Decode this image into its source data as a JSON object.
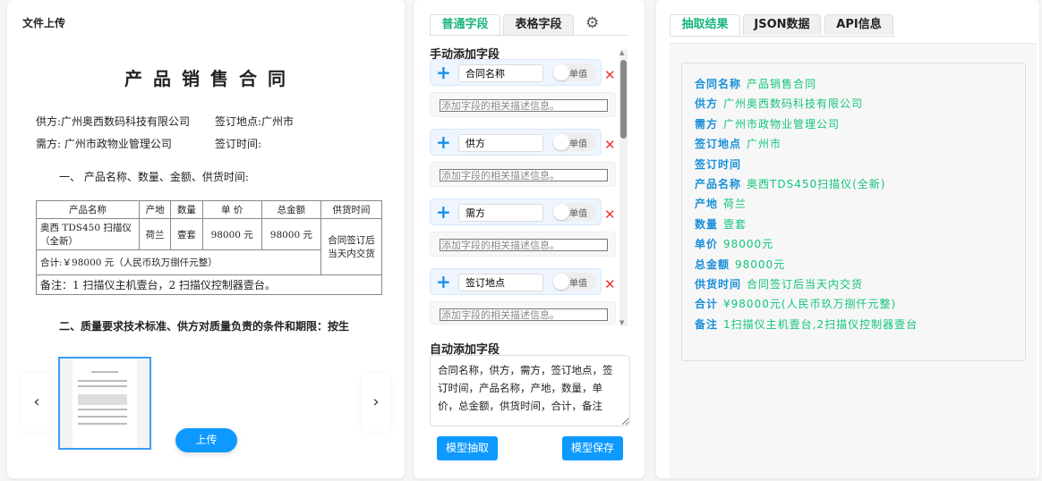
{
  "left": {
    "title": "文件上传",
    "upload_label": "上传",
    "prev_icon": "chevron-left",
    "next_icon": "chevron-right",
    "document": {
      "title": "产品销售合同",
      "supplier": "供方:广州奥西数码科技有限公司",
      "sign_place": "签订地点:广州市",
      "buyer": "需方: 广州市政物业管理公司",
      "sign_time": "签订时间:",
      "section1": "一、  产品名称、数量、金额、供货时间:",
      "table_headers": [
        "产品名称",
        "产地",
        "数量",
        "单 价",
        "总金额",
        "供货时间"
      ],
      "table_row": [
        "奥西 TDS450 扫描仪（全新）",
        "荷兰",
        "壹套",
        "98000 元",
        "98000 元",
        "合同签订后当天内交货"
      ],
      "total": "合计:￥98000 元（人民币玖万捌仟元整）",
      "note": "备注：1 扫描仪主机壹台，2 扫描仪控制器壹台。",
      "section2": "二、质量要求技术标准、供方对质量负责的条件和期限：按生"
    }
  },
  "middle": {
    "tabs": [
      "普通字段",
      "表格字段"
    ],
    "settings_icon": "gear",
    "manual_label": "手动添加字段",
    "toggle_label": "单值",
    "desc_placeholder": "添加字段的相关描述信息。",
    "fields": [
      "合同名称",
      "供方",
      "需方",
      "签订地点"
    ],
    "auto_label": "自动添加字段",
    "auto_value": "合同名称，供方，需方，签订地点，签订时间，产品名称，产地，数量，单价，总金额，供货时间，合计，备注",
    "extract_button": "模型抽取",
    "save_button": "模型保存"
  },
  "right": {
    "tabs": [
      "抽取结果",
      "JSON数据",
      "API信息"
    ],
    "results": [
      {
        "key": "合同名称",
        "value": "产品销售合同"
      },
      {
        "key": "供方",
        "value": "广州奥西数码科技有限公司"
      },
      {
        "key": "需方",
        "value": "广州市政物业管理公司"
      },
      {
        "key": "签订地点",
        "value": "广州市"
      },
      {
        "key": "签订时间",
        "value": ""
      },
      {
        "key": "产品名称",
        "value": "奥西TDS450扫描仪(全新)"
      },
      {
        "key": "产地",
        "value": "荷兰"
      },
      {
        "key": "数量",
        "value": "壹套"
      },
      {
        "key": "单价",
        "value": "98000元"
      },
      {
        "key": "总金额",
        "value": "98000元"
      },
      {
        "key": "供货时间",
        "value": "合同签订后当天内交货"
      },
      {
        "key": "合计",
        "value": "¥98000元(人民币玖万捌仟元整)"
      },
      {
        "key": "备注",
        "value": "1扫描仪主机壹台,2扫描仪控制器壹台"
      }
    ]
  },
  "colors": {
    "accent": "#0d99ff",
    "label": "#1a8fd8",
    "value": "#13c47a",
    "tab_active": "#19b57a",
    "delete": "#e33333"
  }
}
